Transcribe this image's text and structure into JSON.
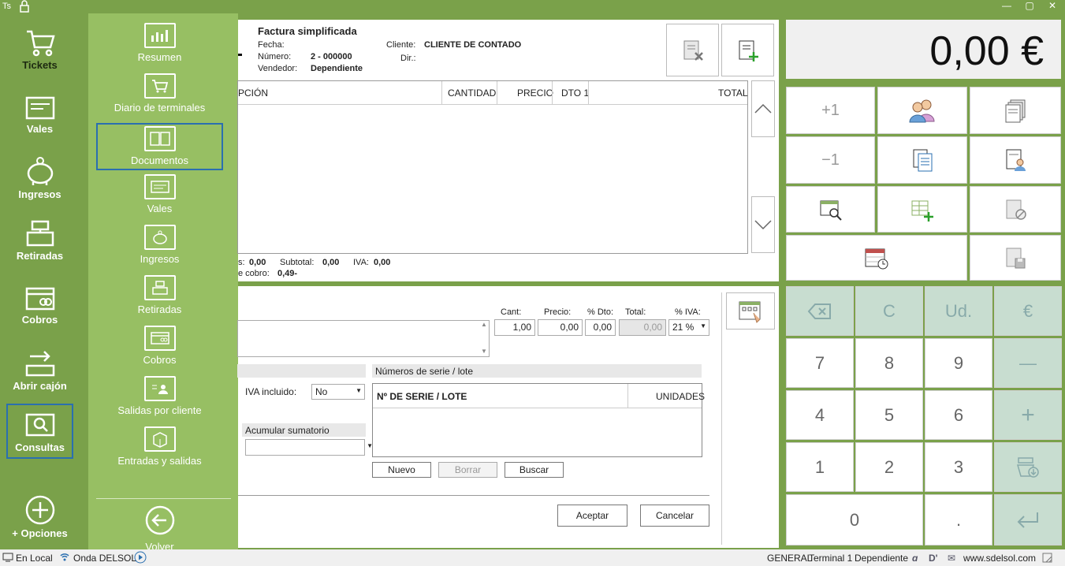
{
  "titlebar": {
    "app_abbr": "Ts"
  },
  "sidebar": {
    "items": [
      {
        "label": "Tickets"
      },
      {
        "label": "Vales"
      },
      {
        "label": "Ingresos"
      },
      {
        "label": "Retiradas"
      },
      {
        "label": "Cobros"
      },
      {
        "label": "Abrir cajón"
      },
      {
        "label": "Consultas"
      }
    ],
    "options_label": "+ Opciones"
  },
  "submenu": {
    "items": [
      {
        "label": "Resumen"
      },
      {
        "label": "Diario de terminales"
      },
      {
        "label": "Documentos"
      },
      {
        "label": "Vales"
      },
      {
        "label": "Ingresos"
      },
      {
        "label": "Retiradas"
      },
      {
        "label": "Cobros"
      },
      {
        "label": "Salidas por cliente"
      },
      {
        "label": "Entradas y salidas"
      }
    ],
    "back_label": "Volver"
  },
  "document": {
    "type": "Factura simplificada",
    "fecha_label": "Fecha:",
    "numero_label": "Número:",
    "numero_value": "2 - 000000",
    "vendedor_label": "Vendedor:",
    "vendedor_value": "Dependiente",
    "cliente_label": "Cliente:",
    "cliente_value": "CLIENTE DE CONTADO",
    "dir_label": "Dir.:",
    "columns": [
      "PCIÓN",
      "CANTIDAD",
      "PRECIO",
      "DTO 1",
      "TOTAL"
    ],
    "footer": {
      "a_label": "s:",
      "a_value": "0,00",
      "subtotal_label": "Subtotal:",
      "subtotal_value": "0,00",
      "iva_label": "IVA:",
      "iva_value": "0,00",
      "cobro_label": "e cobro:",
      "cobro_value": "0,49-"
    }
  },
  "line_editor": {
    "cant_label": "Cant:",
    "cant_value": "1,00",
    "precio_label": "Precio:",
    "precio_value": "0,00",
    "dto_label": "% Dto:",
    "dto_value": "0,00",
    "total_label": "Total:",
    "total_value": "0,00",
    "iva_label": "% IVA:",
    "iva_value": "21 %",
    "iva_incluido_label": "IVA incluido:",
    "iva_incluido_value": "No",
    "acumular_label": "Acumular sumatorio",
    "serie_section": "Números de serie / lote",
    "serie_col": "Nº DE SERIE / LOTE",
    "unidades_col": "UNIDADES",
    "nuevo": "Nuevo",
    "borrar": "Borrar",
    "buscar": "Buscar",
    "aceptar": "Aceptar",
    "cancelar": "Cancelar"
  },
  "total_display": "0,00 €",
  "actions": {
    "plus_one": "+1",
    "minus_one": "−1"
  },
  "keypad": {
    "back": "",
    "c": "C",
    "ud": "Ud.",
    "eur": "€",
    "k7": "7",
    "k8": "8",
    "k9": "9",
    "minus": "—",
    "k4": "4",
    "k5": "5",
    "k6": "6",
    "plus": "+",
    "k1": "1",
    "k2": "2",
    "k3": "3",
    "k0": "0",
    "dot": "."
  },
  "statusbar": {
    "local": "En Local",
    "onda": "Onda DELSOL",
    "general": "GENERAL",
    "terminal": "Terminal 1",
    "user": "Dependiente",
    "web": "www.sdelsol.com"
  }
}
